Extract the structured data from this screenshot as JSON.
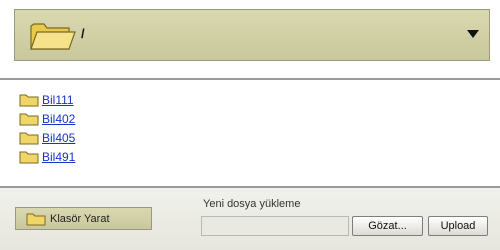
{
  "path_bar": {
    "current_path": "/",
    "folder_icon": "folder-open-icon",
    "dropdown_icon": "dropdown-arrow-icon"
  },
  "folders": [
    {
      "name": "Bil111"
    },
    {
      "name": "Bil402"
    },
    {
      "name": "Bil405"
    },
    {
      "name": "Bil491"
    }
  ],
  "bottom": {
    "create_folder_label": "Klasör Yarat",
    "upload_section_label": "Yeni dosya yükleme",
    "browse_label": "Gözat...",
    "upload_label": "Upload"
  },
  "colors": {
    "panel_khaki": "#d2d1a6",
    "folder_yellow": "#f0d668",
    "link_blue": "#1a33c8"
  }
}
